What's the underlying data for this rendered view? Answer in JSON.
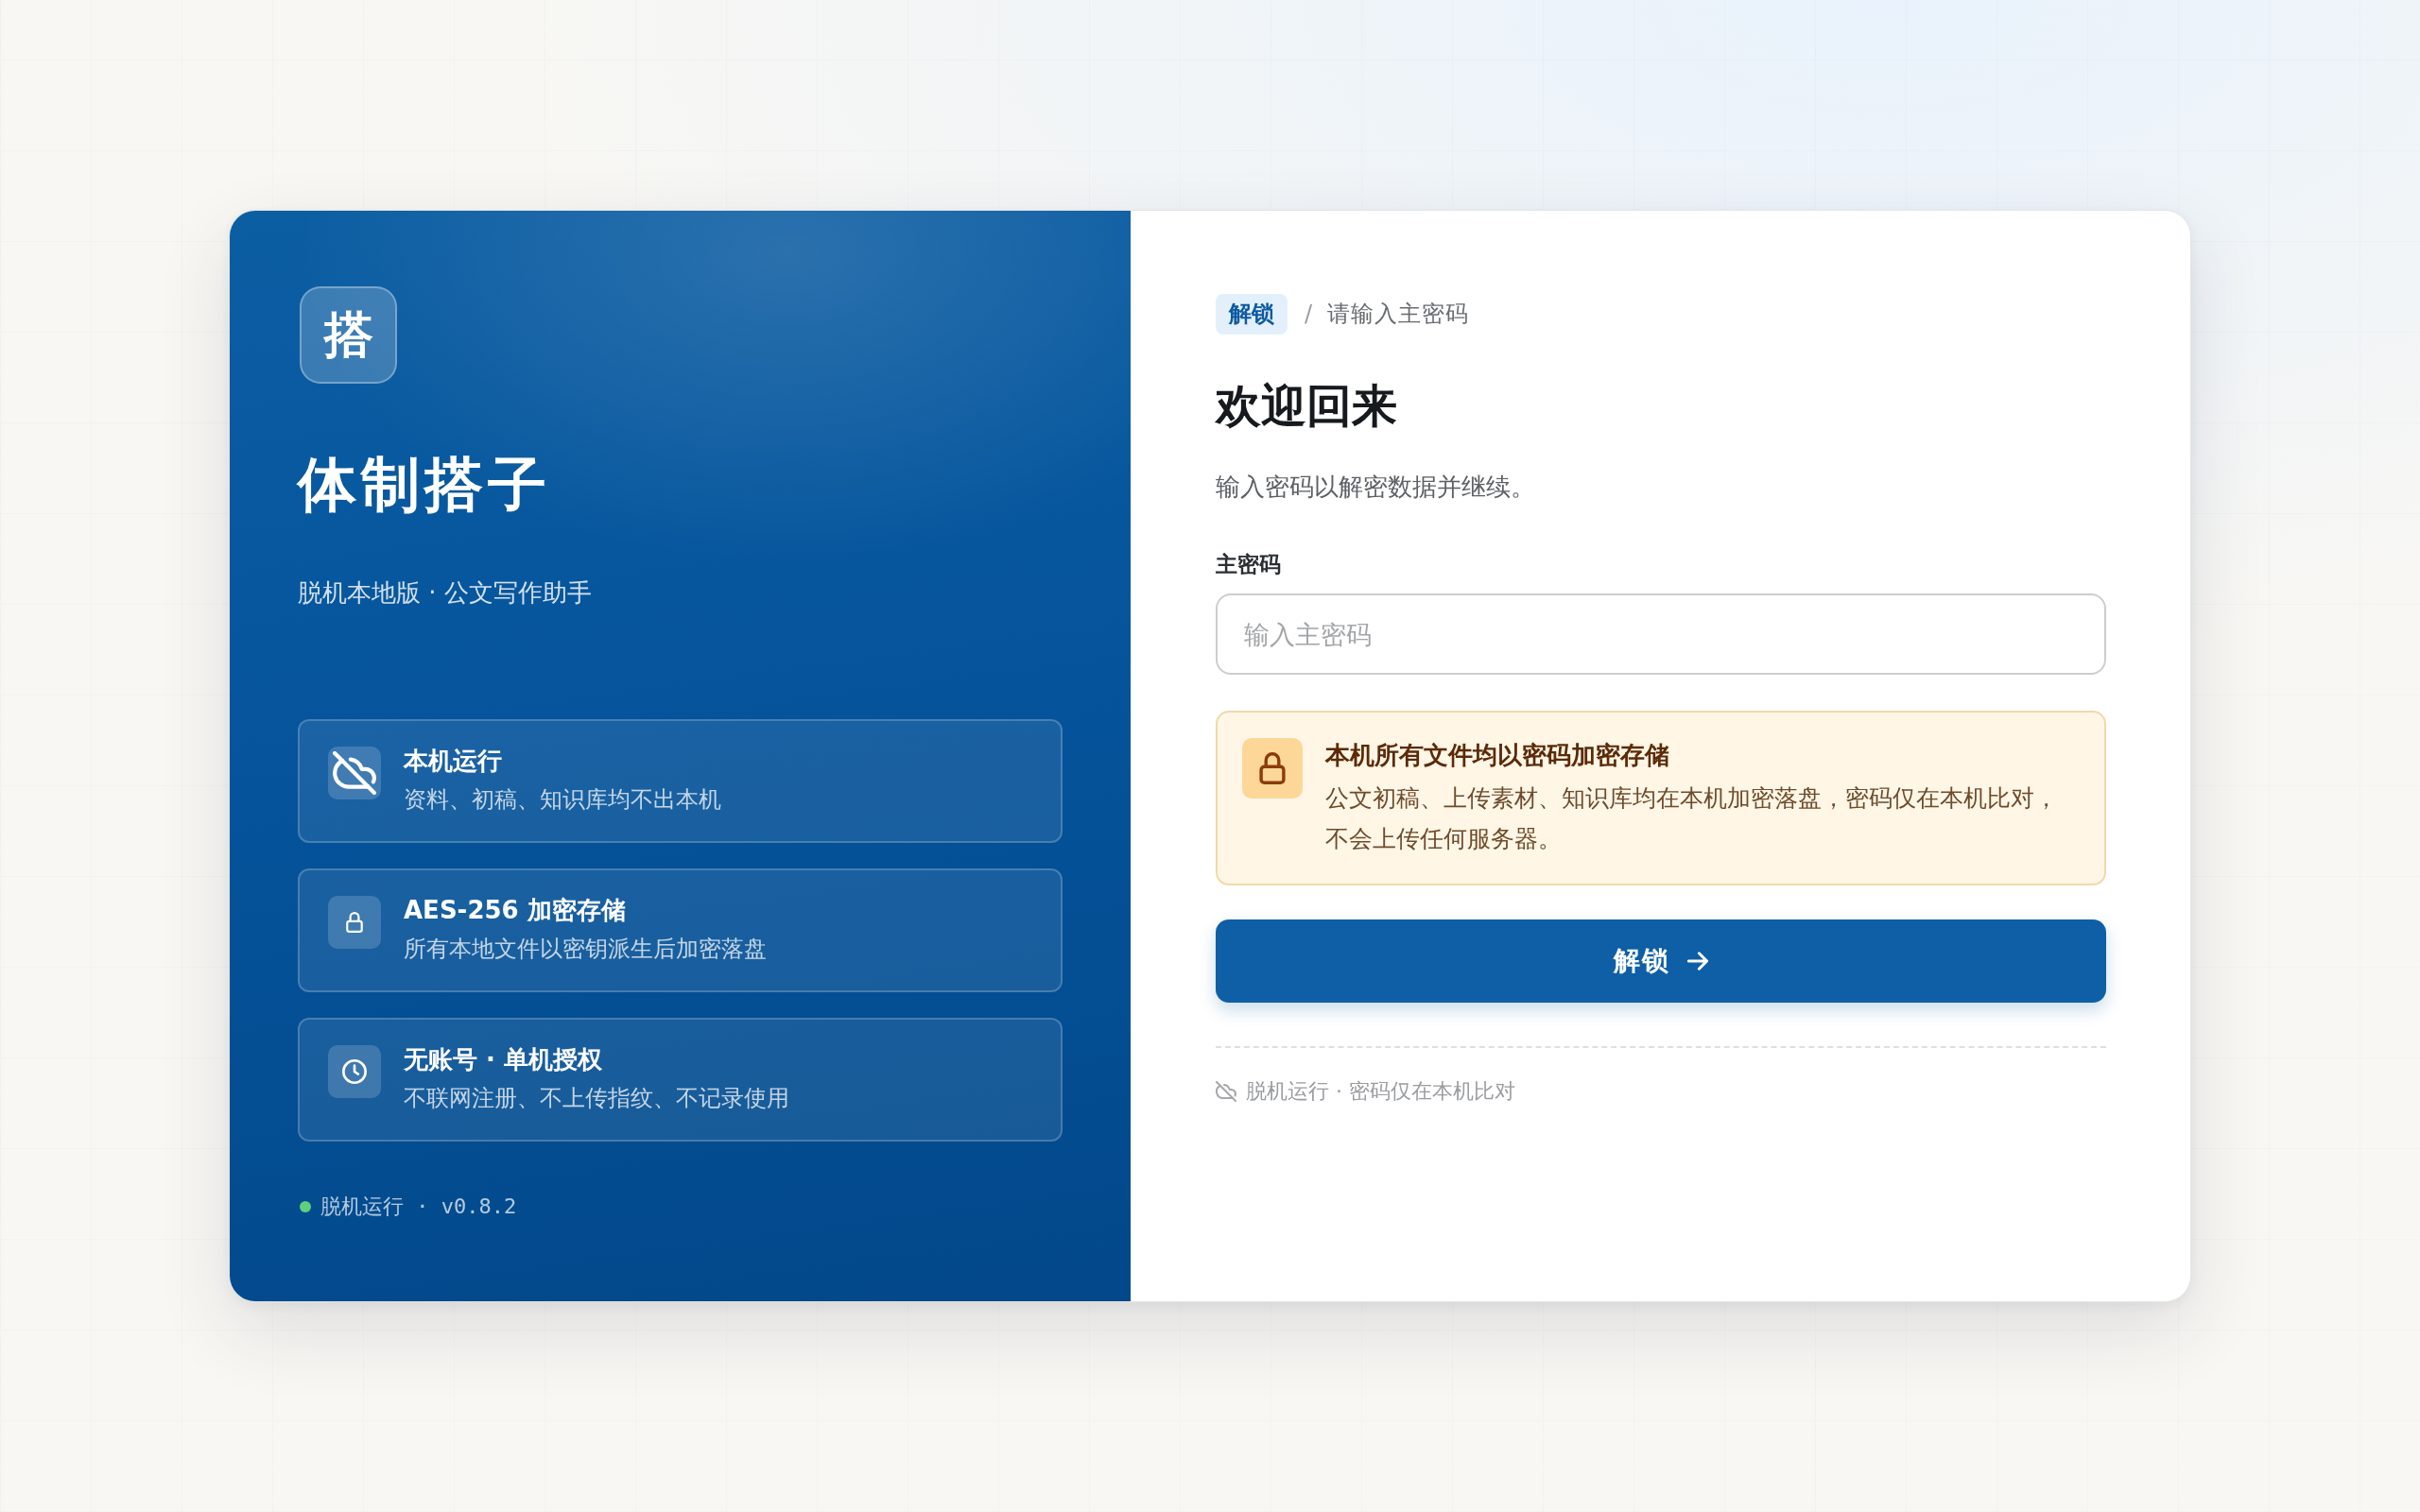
{
  "brand": {
    "logo": "搭",
    "title": "体制搭子",
    "subtitle": "脱机本地版 · 公文写作助手"
  },
  "features": [
    {
      "kind": "offline",
      "title": "本机运行",
      "description": "资料、初稿、知识库均不出本机"
    },
    {
      "kind": "encryption",
      "title": "AES-256 加密存储",
      "description": "所有本地文件以密钥派生后加密落盘"
    },
    {
      "kind": "license",
      "title": "无账号 · 单机授权",
      "description": "不联网注册、不上传指纹、不记录使用"
    }
  ],
  "status": {
    "active": true,
    "text": "脱机运行 · v0.8.2"
  },
  "breadcrumb": {
    "tag": "解锁",
    "separator": "/",
    "current": "请输入主密码"
  },
  "heading": "欢迎回来",
  "description": "输入密码以解密数据并继续。",
  "password_field": {
    "label": "主密码",
    "placeholder": "输入主密码"
  },
  "notice": {
    "title": "本机所有文件均以密码加密存储",
    "body": "公文初稿、上传素材、知识库均在本机加密落盘，密码仅在本机比对，不会上传任何服务器。"
  },
  "unlock_button": {
    "label": "解锁"
  },
  "footer_note": "脱机运行 · 密码仅在本机比对"
}
